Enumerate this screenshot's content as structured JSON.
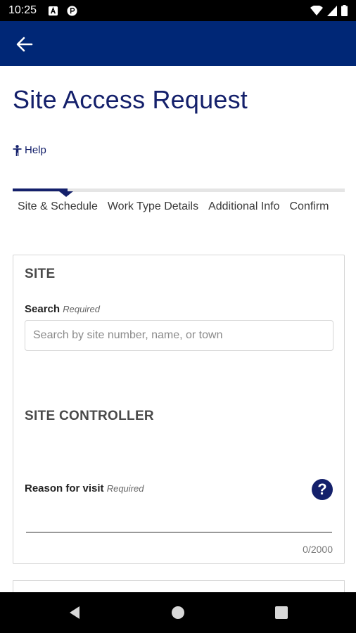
{
  "status_bar": {
    "time": "10:25",
    "icons": [
      "a-notification-icon",
      "p-notification-icon",
      "wifi-icon",
      "signal-icon",
      "battery-icon"
    ]
  },
  "app_bar": {
    "back_icon": "arrow-left-icon",
    "color": "#002776"
  },
  "page": {
    "title": "Site Access Request",
    "help_label": "Help"
  },
  "stepper": {
    "steps": [
      "Site & Schedule",
      "Work Type Details",
      "Additional Info",
      "Confirm"
    ],
    "active_index": 0
  },
  "site_section": {
    "heading": "SITE",
    "search_label": "Search",
    "search_required": "Required",
    "search_placeholder": "Search by site number, name, or town",
    "search_value": ""
  },
  "controller_section": {
    "heading": "SITE CONTROLLER",
    "reason_label": "Reason for visit",
    "reason_required": "Required",
    "reason_value": "",
    "counter": "0/2000"
  },
  "colors": {
    "brand": "#14206b",
    "appbar": "#002776"
  }
}
